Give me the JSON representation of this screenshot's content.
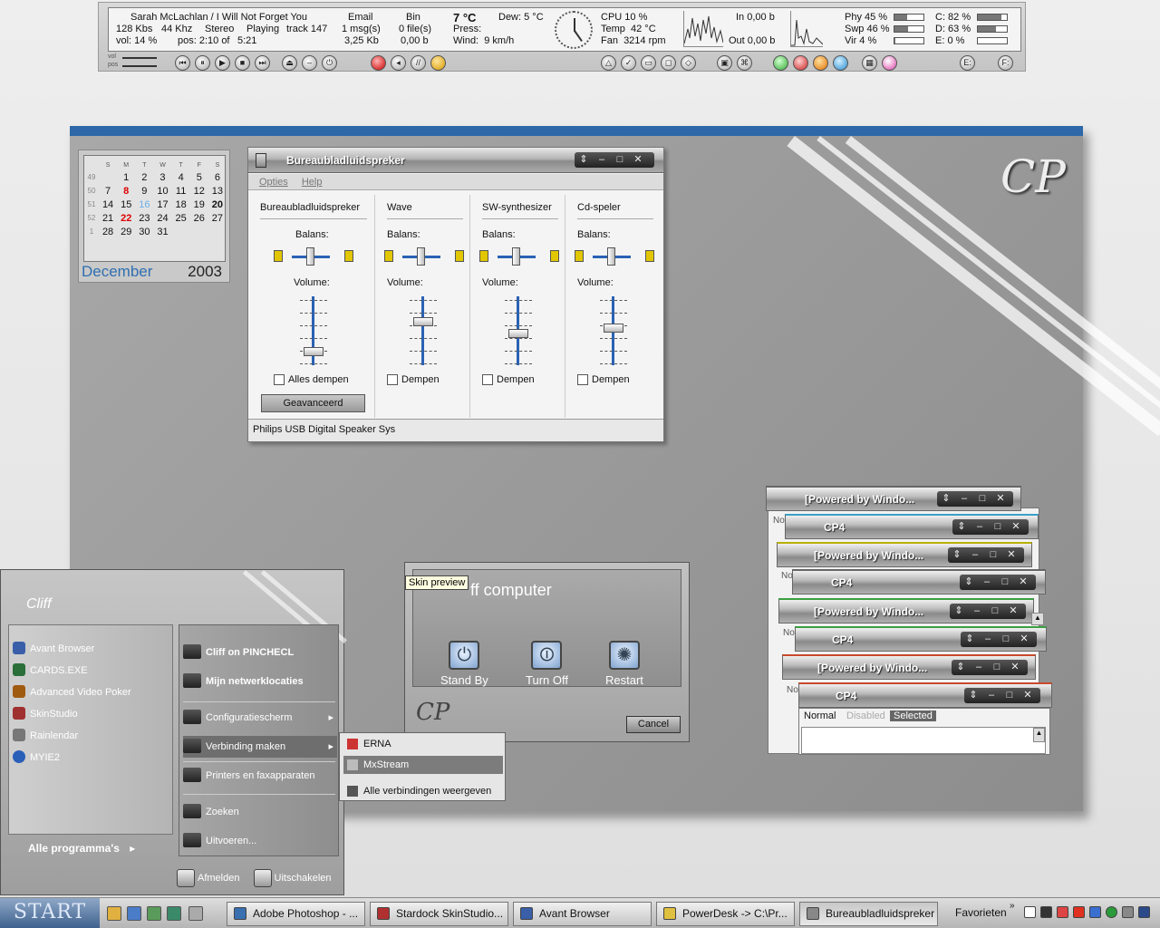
{
  "topbar": {
    "track": "Sarah McLachlan / I Will Not Forget You",
    "kbs": "128 Kbs",
    "khz": "44 Khz",
    "stereo": "Stereo",
    "playing": "Playing",
    "tracknum": "track 147",
    "vol": "vol: 14 %",
    "pos": "pos: 2:10 of",
    "len": "5:21",
    "vol_small": "vol",
    "pos_small": "pos",
    "email_label": "Email",
    "email_value": "1 msg(s)",
    "email_size": "3,25 Kb",
    "bin_label": "Bin",
    "bin_value": "0 file(s)",
    "bin_size": "0,00 b",
    "temp": "7 °C",
    "dew": "Dew: 5 °C",
    "press": "Press:",
    "wind": "Wind:  9 km/h",
    "cpu": "CPU 10 %",
    "cpu_temp": "Temp  42 °C",
    "fan": "Fan  3214 rpm",
    "net_in": "In 0,00 b",
    "net_out": "Out 0,00 b",
    "phy": "Phy 45 %",
    "swp": "Swp 46 %",
    "vir": "Vir 4 %",
    "phy_pct": 45,
    "swp_pct": 46,
    "vir_pct": 4,
    "drive_c": "C: 82 %",
    "drive_d": "D: 63 %",
    "drive_e": "E: 0 %",
    "drive_c_pct": 82,
    "drive_d_pct": 63,
    "drive_e_pct": 0,
    "drive_e_btn": "E:",
    "drive_f_btn": "F:"
  },
  "calendar": {
    "month": "December",
    "year": "2003",
    "days": [
      "S",
      "M",
      "T",
      "W",
      "T",
      "F",
      "S"
    ],
    "rows": [
      {
        "wk": "49",
        "d": [
          "",
          "1",
          "2",
          "3",
          "4",
          "5",
          "6"
        ]
      },
      {
        "wk": "50",
        "d": [
          "7",
          "8",
          "9",
          "10",
          "11",
          "12",
          "13"
        ]
      },
      {
        "wk": "51",
        "d": [
          "14",
          "15",
          "16",
          "17",
          "18",
          "19",
          "20"
        ]
      },
      {
        "wk": "52",
        "d": [
          "21",
          "22",
          "23",
          "24",
          "25",
          "26",
          "27"
        ]
      },
      {
        "wk": "1",
        "d": [
          "28",
          "29",
          "30",
          "31",
          "",
          "",
          ""
        ]
      }
    ]
  },
  "mixer": {
    "title": "Bureaubladluidspreker",
    "menu": [
      "Opties",
      "Help"
    ],
    "balance_label": "Balans:",
    "volume_label": "Volume:",
    "columns": [
      {
        "name": "Bureaubladluidspreker",
        "mute": "Alles dempen",
        "volume_level": 0.15
      },
      {
        "name": "Wave",
        "mute": "Dempen",
        "volume_level": 0.65
      },
      {
        "name": "SW-synthesizer",
        "mute": "Dempen",
        "volume_level": 0.45
      },
      {
        "name": "Cd-speler",
        "mute": "Dempen",
        "volume_level": 0.55
      }
    ],
    "advanced": "Geavanceerd",
    "status": "Philips USB Digital Speaker Sys"
  },
  "cascade": {
    "powered": "[Powered by Windo...",
    "cp4": "CP4",
    "tab_normal": "Normal",
    "tab_disabled": "Disabled",
    "tab_selected": "Selected",
    "no_prefix": "No"
  },
  "turnoff": {
    "tooltip": "Skin preview",
    "heading": "ff computer",
    "standby": "Stand By",
    "turnoff": "Turn Off",
    "restart": "Restart",
    "cancel": "Cancel",
    "logo": "CP"
  },
  "startmenu": {
    "user": "Cliff",
    "left_items": [
      "Avant Browser",
      "CARDS.EXE",
      "Advanced Video Poker",
      "SkinStudio",
      "Rainlendar",
      "MYIE2"
    ],
    "right_items": [
      "Cliff on PINCHECL",
      "Mijn netwerklocaties",
      "Configuratiescherm",
      "Verbinding maken",
      "Printers en faxapparaten",
      "Zoeken",
      "Uitvoeren..."
    ],
    "all_programs": "Alle programma's",
    "logoff": "Afmelden",
    "shutdown": "Uitschakelen"
  },
  "submenu": {
    "items": [
      "ERNA",
      "MxStream",
      "Alle verbindingen weergeven"
    ]
  },
  "taskbar": {
    "start": "START",
    "tasks": [
      "Adobe Photoshop - ...",
      "Stardock SkinStudio...",
      "Avant Browser",
      "PowerDesk -> C:\\Pr...",
      "Bureaubladluidspreker"
    ],
    "favorites": "Favorieten"
  },
  "logo": "CP"
}
